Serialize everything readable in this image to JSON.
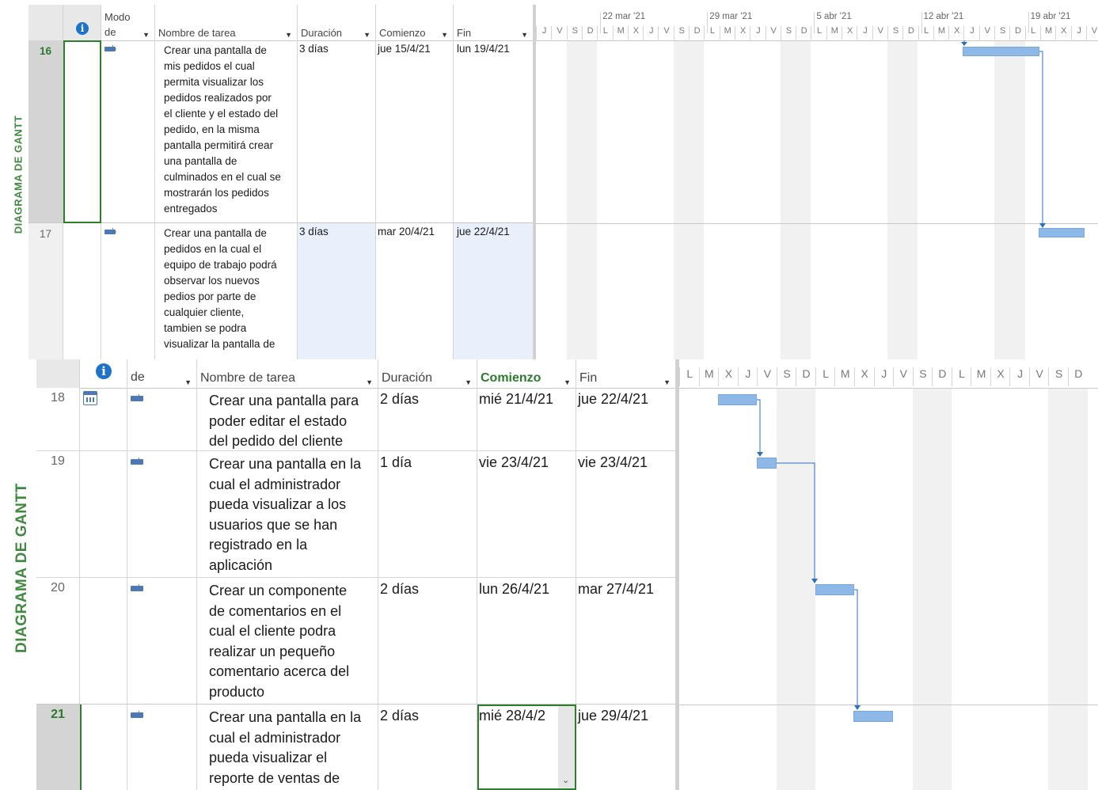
{
  "side_label": "DIAGRAMA DE GANTT",
  "icons": {
    "info": "info-icon",
    "task_mode": "auto-scheduled-task-icon",
    "calendar": "calendar-icon",
    "dropdown": "chevron-down-icon"
  },
  "colors": {
    "bar": "#8db8e8",
    "link": "#2b6fc4",
    "side": "#3f8a3f"
  },
  "top": {
    "headers": {
      "info": "i",
      "mode": "Modo\nde",
      "name": "Nombre de tarea",
      "duration": "Duración",
      "start": "Comienzo",
      "end": "Fin"
    },
    "timeline": {
      "weeks": [
        "22 mar '21",
        "29 mar '21",
        "5 abr '21",
        "12 abr '21",
        "19 abr '21"
      ],
      "days": [
        "J",
        "V",
        "S",
        "D",
        "L",
        "M",
        "X",
        "J",
        "V",
        "S",
        "D",
        "L",
        "M",
        "X",
        "J",
        "V",
        "S",
        "D",
        "L",
        "M",
        "X",
        "J",
        "V",
        "S",
        "D",
        "L",
        "M",
        "X",
        "J",
        "V",
        "S",
        "D",
        "L",
        "M",
        "X",
        "J",
        "V"
      ]
    },
    "rows": [
      {
        "id": "16",
        "name": "Crear una pantalla de\nmis pedidos el cual\npermita visualizar los\npedidos realizados por\nel cliente y el estado del\npedido, en la misma\npantalla permitirá crear\nuna pantalla de\nculminados en el cual se\nmostrarán los pedidos\nentregados",
        "duration": "3 días",
        "start": "jue 15/4/21",
        "end": "lun 19/4/21"
      },
      {
        "id": "17",
        "name": "Crear una pantalla de\npedidos en la cual el\nequipo de trabajo podrá\nobservar los nuevos\npedios por parte de\ncualquier cliente,\ntambien se podra\nvisualizar la pantalla de",
        "duration": "3 días",
        "start": "mar 20/4/21",
        "end": "jue 22/4/21"
      }
    ]
  },
  "bottom": {
    "headers": {
      "info": "i",
      "mode": "de",
      "name": "Nombre de tarea",
      "duration": "Duración",
      "start": "Comienzo",
      "end": "Fin"
    },
    "timeline": {
      "days": [
        "L",
        "M",
        "X",
        "J",
        "V",
        "S",
        "D",
        "L",
        "M",
        "X",
        "J",
        "V",
        "S",
        "D",
        "L",
        "M",
        "X",
        "J",
        "V",
        "S",
        "D"
      ]
    },
    "rows": [
      {
        "id": "18",
        "name": "Crear una pantalla para\npoder editar el estado\ndel pedido del cliente",
        "duration": "2 días",
        "start": "mié 21/4/21",
        "end": "jue 22/4/21"
      },
      {
        "id": "19",
        "name": "Crear una pantalla en la\ncual el administrador\npueda visualizar a los\nusuarios que se han\nregistrado en la\naplicación",
        "duration": "1 día",
        "start": "vie 23/4/21",
        "end": "vie 23/4/21"
      },
      {
        "id": "20",
        "name": "Crear un componente\nde comentarios en el\ncual el cliente podra\nrealizar un pequeño\ncomentario acerca del\nproducto",
        "duration": "2 días",
        "start": "lun 26/4/21",
        "end": "mar 27/4/21"
      },
      {
        "id": "21",
        "name": "Crear una pantalla en la\ncual el administrador\npueda visualizar el\nreporte de ventas de",
        "duration": "2 días",
        "start": "mié 28/4/2",
        "end": "jue 29/4/21"
      }
    ]
  }
}
